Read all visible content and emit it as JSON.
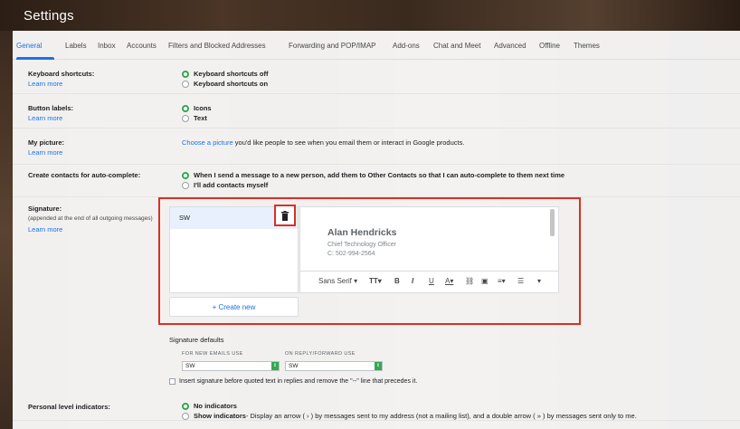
{
  "title": "Settings",
  "tabs": [
    "General",
    "Labels",
    "Inbox",
    "Accounts",
    "Filters and Blocked Addresses",
    "Forwarding and POP/IMAP",
    "Add-ons",
    "Chat and Meet",
    "Advanced",
    "Offline",
    "Themes"
  ],
  "active_tab": "General",
  "keyboard_shortcuts": {
    "label": "Keyboard shortcuts:",
    "learn_more": "Learn more",
    "options": [
      "Keyboard shortcuts off",
      "Keyboard shortcuts on"
    ],
    "selected": 0
  },
  "button_labels": {
    "label": "Button labels:",
    "learn_more": "Learn more",
    "options": [
      "Icons",
      "Text"
    ],
    "selected": 0
  },
  "my_picture": {
    "label": "My picture:",
    "learn_more": "Learn more",
    "link": "Choose a picture",
    "text": " you'd like people to see when you email them or interact in Google products."
  },
  "contacts": {
    "label": "Create contacts for auto-complete:",
    "options": [
      "When I send a message to a new person, add them to Other Contacts so that I can auto-complete to them next time",
      "I'll add contacts myself"
    ],
    "selected": 0
  },
  "signature": {
    "label": "Signature:",
    "sublabel": "(appended at the end of all outgoing messages)",
    "learn_more": "Learn more",
    "list_item": "SW",
    "content": {
      "name": "Alan Hendricks",
      "line1": "Chief Technology Officer",
      "line2": "C: 502-994-2564"
    },
    "toolbar": {
      "font": "Sans Serif",
      "size": "TT",
      "bold": "B",
      "italic": "I",
      "underline": "U",
      "color": "A"
    },
    "create_new": "+ Create new",
    "defaults_title": "Signature defaults",
    "new_emails_label": "FOR NEW EMAILS USE",
    "reply_label": "ON REPLY/FORWARD USE",
    "new_emails_value": "SW",
    "reply_value": "SW",
    "insert_text": "Insert signature before quoted text in replies and remove the \"--\" line that precedes it."
  },
  "personal_level": {
    "label": "Personal level indicators:",
    "options": [
      "No indicators",
      "Show indicators"
    ],
    "show_desc": " - Display an arrow ( › ) by messages sent to my address (not a mailing list), and a double arrow ( » ) by messages sent only to me.",
    "selected": 0
  },
  "colors": {
    "accent": "#1a73e8",
    "radio_on": "#34a853",
    "highlight": "#d93025"
  }
}
